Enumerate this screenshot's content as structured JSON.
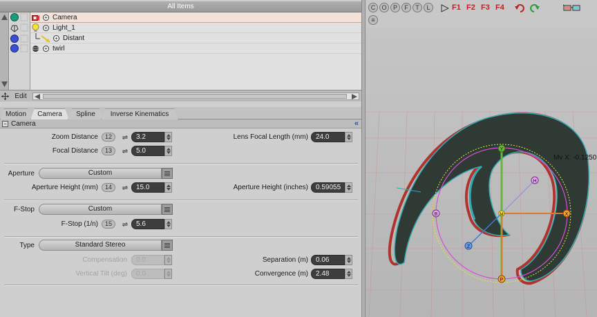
{
  "items_panel": {
    "title": "All Items",
    "edit_label": "Edit",
    "items": [
      {
        "label": "Camera",
        "selected": true
      },
      {
        "label": "Light_1",
        "selected": false
      },
      {
        "label": "Distant",
        "selected": false
      },
      {
        "label": "twirl",
        "selected": false
      }
    ]
  },
  "tabs": [
    "Motion",
    "Camera",
    "Spline",
    "Inverse Kinematics"
  ],
  "active_tab": "Camera",
  "section_title": "Camera",
  "props": {
    "zoom_distance": {
      "label": "Zoom Distance",
      "badge": "12",
      "value": "3.2"
    },
    "focal_distance": {
      "label": "Focal Distance",
      "badge": "13",
      "value": "5.0"
    },
    "lens_focal_length": {
      "label": "Lens Focal Length (mm)",
      "value": "24.0"
    },
    "aperture": {
      "label": "Aperture",
      "value": "Custom"
    },
    "aperture_height_mm": {
      "label": "Aperture Height (mm)",
      "badge": "14",
      "value": "15.0"
    },
    "aperture_height_in": {
      "label": "Aperture Height (inches)",
      "value": "0.59055"
    },
    "fstop": {
      "label": "F-Stop",
      "value": "Custom"
    },
    "fstop_n": {
      "label": "F-Stop (1/n)",
      "badge": "15",
      "value": "5.6"
    },
    "type": {
      "label": "Type",
      "value": "Standard Stereo"
    },
    "compensation": {
      "label": "Compensation",
      "value": "0.0"
    },
    "vertical_tilt": {
      "label": "Vertical Tilt (deg)",
      "value": "0.0"
    },
    "separation": {
      "label": "Separation (m)",
      "value": "0.06"
    },
    "convergence": {
      "label": "Convergence (m)",
      "value": "2.48"
    }
  },
  "viewport": {
    "buttons": [
      "C",
      "O",
      "P",
      "F",
      "T",
      "L"
    ],
    "fkeys": [
      "F1",
      "F2",
      "F3",
      "F4"
    ],
    "mv_readout": "Mv X: -0.1250",
    "handle_labels": {
      "y": "Y",
      "x": "X",
      "z": "Z",
      "h": "H",
      "b": "B",
      "p": "P",
      "m": "M"
    },
    "colors": {
      "object": "#2f3a35",
      "red_stereo": "#b0332e",
      "cyan_stereo": "#36a9b0",
      "grid": "#d08080",
      "axis_y": "#6ab53e",
      "axis_x": "#e07a2a",
      "ring": "#d64fd6"
    }
  }
}
